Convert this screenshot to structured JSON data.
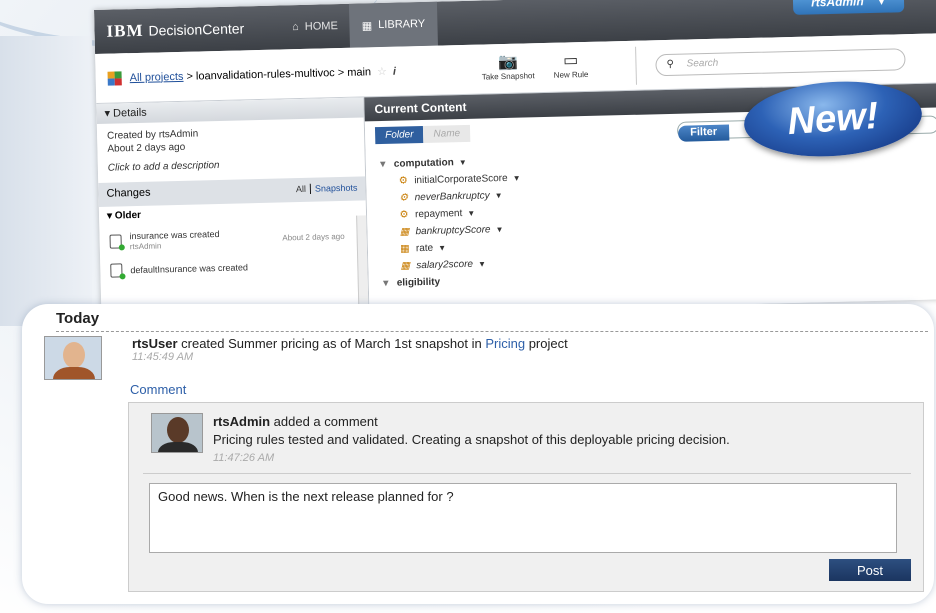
{
  "app": {
    "brand_ibm": "IBM",
    "brand_name": "DecisionCenter",
    "nav": [
      {
        "label": "HOME",
        "icon": "home-icon"
      },
      {
        "label": "LIBRARY",
        "icon": "library-icon"
      }
    ],
    "user": "rtsAdmin",
    "breadcrumb": {
      "root": "All projects",
      "path": " > loanvalidation-rules-multivoc > main"
    },
    "toolbar": {
      "snapshot_label": "Take Snapshot",
      "new_rule_label": "New Rule"
    },
    "search_placeholder": "Search"
  },
  "details": {
    "header": "Details",
    "created_by": "Created by rtsAdmin",
    "created_when": "About 2 days ago",
    "description_hint": "Click to add a description"
  },
  "changes": {
    "header": "Changes",
    "filter_all": "All",
    "filter_snapshots": "Snapshots",
    "group": "Older",
    "items": [
      {
        "text": "insurance was created",
        "author": "rtsAdmin",
        "when": "About 2 days ago"
      },
      {
        "text": "defaultInsurance was created",
        "author": "",
        "when": ""
      }
    ]
  },
  "content": {
    "header": "Current Content",
    "tab_folder": "Folder",
    "tab_name": "Name",
    "filter_label": "Filter",
    "tree": [
      {
        "label": "computation",
        "kind": "folder"
      },
      {
        "label": "initialCorporateScore",
        "kind": "rule"
      },
      {
        "label": "neverBankruptcy",
        "kind": "rule"
      },
      {
        "label": "repayment",
        "kind": "rule"
      },
      {
        "label": "bankruptcyScore",
        "kind": "table"
      },
      {
        "label": "rate",
        "kind": "table"
      },
      {
        "label": "salary2score",
        "kind": "table"
      },
      {
        "label": "eligibility",
        "kind": "folder"
      }
    ]
  },
  "badge": {
    "text": "New!"
  },
  "activity": {
    "section": "Today",
    "entry": {
      "user": "rtsUser",
      "text_before": " created Summer pricing as of March 1st snapshot in ",
      "project": "Pricing",
      "text_after": " project",
      "time": "11:45:49 AM"
    },
    "comment_link": "Comment",
    "reply": {
      "user": "rtsAdmin",
      "action": " added a comment",
      "message": "Pricing rules tested and validated. Creating a snapshot of this deployable pricing decision.",
      "time": "11:47:26 AM"
    },
    "new_comment_value": "Good news. When is the next release planned for ?",
    "post_label": "Post"
  },
  "colors": {
    "accent": "#2d5fa8",
    "header_dark": "#3c4046",
    "post_button": "#1b3560"
  }
}
